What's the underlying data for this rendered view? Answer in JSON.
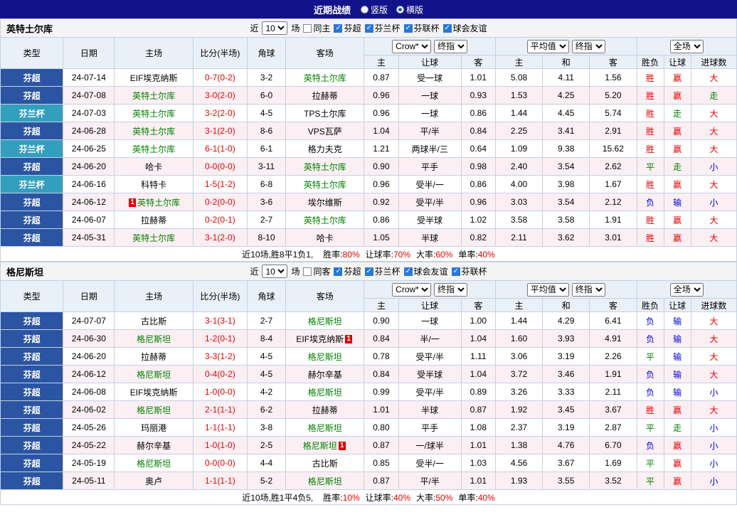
{
  "topbar": {
    "title": "近期战绩",
    "layout_options": [
      {
        "label": "竖版",
        "selected": false
      },
      {
        "label": "横版",
        "selected": true
      }
    ]
  },
  "colors": {
    "league_bg": {
      "芬超": "#2B55A2",
      "芬兰杯": "#339FBE"
    },
    "result": {
      "胜": "#E60000",
      "平": "#008000",
      "负": "#0000D8",
      "赢": "#E60000",
      "走": "#008000",
      "输": "#0000D8",
      "大": "#E60000",
      "小": "#0000D8"
    },
    "score": "#E60000",
    "focus_team": "#008000"
  },
  "table_header": {
    "static_cols": [
      "类型",
      "日期",
      "主场",
      "比分(半场)",
      "角球",
      "客场"
    ],
    "odds_group": {
      "company_select": "Crow*",
      "stage_select": "终指",
      "subs": [
        "主",
        "让球",
        "客"
      ]
    },
    "avg_group": {
      "avg_select": "平均值",
      "stage_select": "终指",
      "subs": [
        "主",
        "和",
        "客"
      ]
    },
    "fulltime_group": {
      "scope_select": "全场",
      "subs": [
        "胜负",
        "让球",
        "进球数"
      ]
    }
  },
  "sections": [
    {
      "team": "英特土尔库",
      "filter": {
        "prefix": "近",
        "count": "10",
        "suffix": "场",
        "checkboxes": [
          {
            "label": "同主",
            "checked": false
          },
          {
            "label": "芬超",
            "checked": true
          },
          {
            "label": "芬兰杯",
            "checked": true
          },
          {
            "label": "芬联杯",
            "checked": true
          },
          {
            "label": "球会友谊",
            "checked": true
          }
        ]
      },
      "rows": [
        {
          "league": "芬超",
          "date": "24-07-14",
          "home": "EIF埃克纳斯",
          "home_focus": false,
          "score": "0-7(0-2)",
          "corners": "3-2",
          "away": "英特土尔库",
          "away_focus": true,
          "asia": [
            "0.87",
            "受一球",
            "1.01"
          ],
          "avg": [
            "5.08",
            "4.11",
            "1.56"
          ],
          "results": [
            "胜",
            "赢",
            "大"
          ]
        },
        {
          "league": "芬超",
          "date": "24-07-08",
          "home": "英特土尔库",
          "home_focus": true,
          "score": "3-0(2-0)",
          "corners": "6-0",
          "away": "拉赫蒂",
          "away_focus": false,
          "asia": [
            "0.96",
            "一球",
            "0.93"
          ],
          "avg": [
            "1.53",
            "4.25",
            "5.20"
          ],
          "results": [
            "胜",
            "赢",
            "走"
          ]
        },
        {
          "league": "芬兰杯",
          "date": "24-07-03",
          "home": "英特土尔库",
          "home_focus": true,
          "score": "3-2(2-0)",
          "corners": "4-5",
          "away": "TPS土尔库",
          "away_focus": false,
          "asia": [
            "0.96",
            "一球",
            "0.86"
          ],
          "avg": [
            "1.44",
            "4.45",
            "5.74"
          ],
          "results": [
            "胜",
            "走",
            "大"
          ]
        },
        {
          "league": "芬超",
          "date": "24-06-28",
          "home": "英特土尔库",
          "home_focus": true,
          "score": "3-1(2-0)",
          "corners": "8-6",
          "away": "VPS瓦萨",
          "away_focus": false,
          "asia": [
            "1.04",
            "平/半",
            "0.84"
          ],
          "avg": [
            "2.25",
            "3.41",
            "2.91"
          ],
          "results": [
            "胜",
            "赢",
            "大"
          ]
        },
        {
          "league": "芬兰杯",
          "date": "24-06-25",
          "home": "英特土尔库",
          "home_focus": true,
          "score": "6-1(1-0)",
          "corners": "6-1",
          "away": "格力夫克",
          "away_focus": false,
          "asia": [
            "1.21",
            "两球半/三",
            "0.64"
          ],
          "avg": [
            "1.09",
            "9.38",
            "15.62"
          ],
          "results": [
            "胜",
            "赢",
            "大"
          ]
        },
        {
          "league": "芬超",
          "date": "24-06-20",
          "home": "哈卡",
          "home_focus": false,
          "score": "0-0(0-0)",
          "corners": "3-11",
          "away": "英特土尔库",
          "away_focus": true,
          "asia": [
            "0.90",
            "平手",
            "0.98"
          ],
          "avg": [
            "2.40",
            "3.54",
            "2.62"
          ],
          "results": [
            "平",
            "走",
            "小"
          ]
        },
        {
          "league": "芬兰杯",
          "date": "24-06-16",
          "home": "科特卡",
          "home_focus": false,
          "score": "1-5(1-2)",
          "corners": "6-8",
          "away": "英特土尔库",
          "away_focus": true,
          "asia": [
            "0.96",
            "受半/一",
            "0.86"
          ],
          "avg": [
            "4.00",
            "3.98",
            "1.67"
          ],
          "results": [
            "胜",
            "赢",
            "大"
          ]
        },
        {
          "league": "芬超",
          "date": "24-06-12",
          "home": "英特土尔库",
          "home_focus": true,
          "home_badge": "1",
          "score": "0-2(0-0)",
          "corners": "3-6",
          "away": "埃尔维斯",
          "away_focus": false,
          "asia": [
            "0.92",
            "受平/半",
            "0.96"
          ],
          "avg": [
            "3.03",
            "3.54",
            "2.12"
          ],
          "results": [
            "负",
            "输",
            "小"
          ]
        },
        {
          "league": "芬超",
          "date": "24-06-07",
          "home": "拉赫蒂",
          "home_focus": false,
          "score": "0-2(0-1)",
          "corners": "2-7",
          "away": "英特土尔库",
          "away_focus": true,
          "asia": [
            "0.86",
            "受半球",
            "1.02"
          ],
          "avg": [
            "3.58",
            "3.58",
            "1.91"
          ],
          "results": [
            "胜",
            "赢",
            "大"
          ]
        },
        {
          "league": "芬超",
          "date": "24-05-31",
          "home": "英特土尔库",
          "home_focus": true,
          "score": "3-1(2-0)",
          "corners": "8-10",
          "away": "哈卡",
          "away_focus": false,
          "asia": [
            "1.05",
            "半球",
            "0.82"
          ],
          "avg": [
            "2.11",
            "3.62",
            "3.01"
          ],
          "results": [
            "胜",
            "赢",
            "大"
          ]
        }
      ],
      "summary": {
        "record": "近10场,胜8平1负1,",
        "stats": [
          {
            "label": "胜率:",
            "value": "80%"
          },
          {
            "label": "让球率:",
            "value": "70%"
          },
          {
            "label": "大率:",
            "value": "60%"
          },
          {
            "label": "单率:",
            "value": "40%"
          }
        ]
      }
    },
    {
      "team": "格尼斯坦",
      "filter": {
        "prefix": "近",
        "count": "10",
        "suffix": "场",
        "checkboxes": [
          {
            "label": "同客",
            "checked": false
          },
          {
            "label": "芬超",
            "checked": true
          },
          {
            "label": "芬兰杯",
            "checked": true
          },
          {
            "label": "球会友谊",
            "checked": true
          },
          {
            "label": "芬联杯",
            "checked": true
          }
        ]
      },
      "rows": [
        {
          "league": "芬超",
          "date": "24-07-07",
          "home": "古比斯",
          "home_focus": false,
          "score": "3-1(3-1)",
          "corners": "2-7",
          "away": "格尼斯坦",
          "away_focus": true,
          "asia": [
            "0.90",
            "一球",
            "1.00"
          ],
          "avg": [
            "1.44",
            "4.29",
            "6.41"
          ],
          "results": [
            "负",
            "输",
            "大"
          ]
        },
        {
          "league": "芬超",
          "date": "24-06-30",
          "home": "格尼斯坦",
          "home_focus": true,
          "score": "1-2(0-1)",
          "corners": "8-4",
          "away": "EIF埃克纳斯",
          "away_focus": false,
          "away_badge": "1",
          "asia": [
            "0.84",
            "半/一",
            "1.04"
          ],
          "avg": [
            "1.60",
            "3.93",
            "4.91"
          ],
          "results": [
            "负",
            "输",
            "大"
          ]
        },
        {
          "league": "芬超",
          "date": "24-06-20",
          "home": "拉赫蒂",
          "home_focus": false,
          "score": "3-3(1-2)",
          "corners": "4-5",
          "away": "格尼斯坦",
          "away_focus": true,
          "asia": [
            "0.78",
            "受平/半",
            "1.11"
          ],
          "avg": [
            "3.06",
            "3.19",
            "2.26"
          ],
          "results": [
            "平",
            "输",
            "大"
          ]
        },
        {
          "league": "芬超",
          "date": "24-06-12",
          "home": "格尼斯坦",
          "home_focus": true,
          "score": "0-4(0-2)",
          "corners": "4-5",
          "away": "赫尔辛基",
          "away_focus": false,
          "asia": [
            "0.84",
            "受半球",
            "1.04"
          ],
          "avg": [
            "3.72",
            "3.46",
            "1.91"
          ],
          "results": [
            "负",
            "输",
            "大"
          ]
        },
        {
          "league": "芬超",
          "date": "24-06-08",
          "home": "EIF埃克纳斯",
          "home_focus": false,
          "score": "1-0(0-0)",
          "corners": "4-2",
          "away": "格尼斯坦",
          "away_focus": true,
          "asia": [
            "0.99",
            "受平/半",
            "0.89"
          ],
          "avg": [
            "3.26",
            "3.33",
            "2.11"
          ],
          "results": [
            "负",
            "输",
            "小"
          ]
        },
        {
          "league": "芬超",
          "date": "24-06-02",
          "home": "格尼斯坦",
          "home_focus": true,
          "score": "2-1(1-1)",
          "corners": "6-2",
          "away": "拉赫蒂",
          "away_focus": false,
          "asia": [
            "1.01",
            "半球",
            "0.87"
          ],
          "avg": [
            "1.92",
            "3.45",
            "3.67"
          ],
          "results": [
            "胜",
            "赢",
            "大"
          ]
        },
        {
          "league": "芬超",
          "date": "24-05-26",
          "home": "玛丽港",
          "home_focus": false,
          "score": "1-1(1-1)",
          "corners": "3-8",
          "away": "格尼斯坦",
          "away_focus": true,
          "asia": [
            "0.80",
            "平手",
            "1.08"
          ],
          "avg": [
            "2.37",
            "3.19",
            "2.87"
          ],
          "results": [
            "平",
            "走",
            "小"
          ]
        },
        {
          "league": "芬超",
          "date": "24-05-22",
          "home": "赫尔辛基",
          "home_focus": false,
          "score": "1-0(1-0)",
          "corners": "2-5",
          "away": "格尼斯坦",
          "away_focus": true,
          "away_badge": "1",
          "asia": [
            "0.87",
            "一/球半",
            "1.01"
          ],
          "avg": [
            "1.38",
            "4.76",
            "6.70"
          ],
          "results": [
            "负",
            "赢",
            "小"
          ]
        },
        {
          "league": "芬超",
          "date": "24-05-19",
          "home": "格尼斯坦",
          "home_focus": true,
          "score": "0-0(0-0)",
          "corners": "4-4",
          "away": "古比斯",
          "away_focus": false,
          "asia": [
            "0.85",
            "受半/一",
            "1.03"
          ],
          "avg": [
            "4.56",
            "3.67",
            "1.69"
          ],
          "results": [
            "平",
            "赢",
            "小"
          ]
        },
        {
          "league": "芬超",
          "date": "24-05-11",
          "home": "奥卢",
          "home_focus": false,
          "score": "1-1(1-1)",
          "corners": "5-2",
          "away": "格尼斯坦",
          "away_focus": true,
          "asia": [
            "0.87",
            "平/半",
            "1.01"
          ],
          "avg": [
            "1.93",
            "3.55",
            "3.52"
          ],
          "results": [
            "平",
            "赢",
            "小"
          ]
        }
      ],
      "summary": {
        "record": "近10场,胜1平4负5,",
        "stats": [
          {
            "label": "胜率:",
            "value": "10%"
          },
          {
            "label": "让球率:",
            "value": "40%"
          },
          {
            "label": "大率:",
            "value": "50%"
          },
          {
            "label": "单率:",
            "value": "40%"
          }
        ]
      }
    }
  ]
}
